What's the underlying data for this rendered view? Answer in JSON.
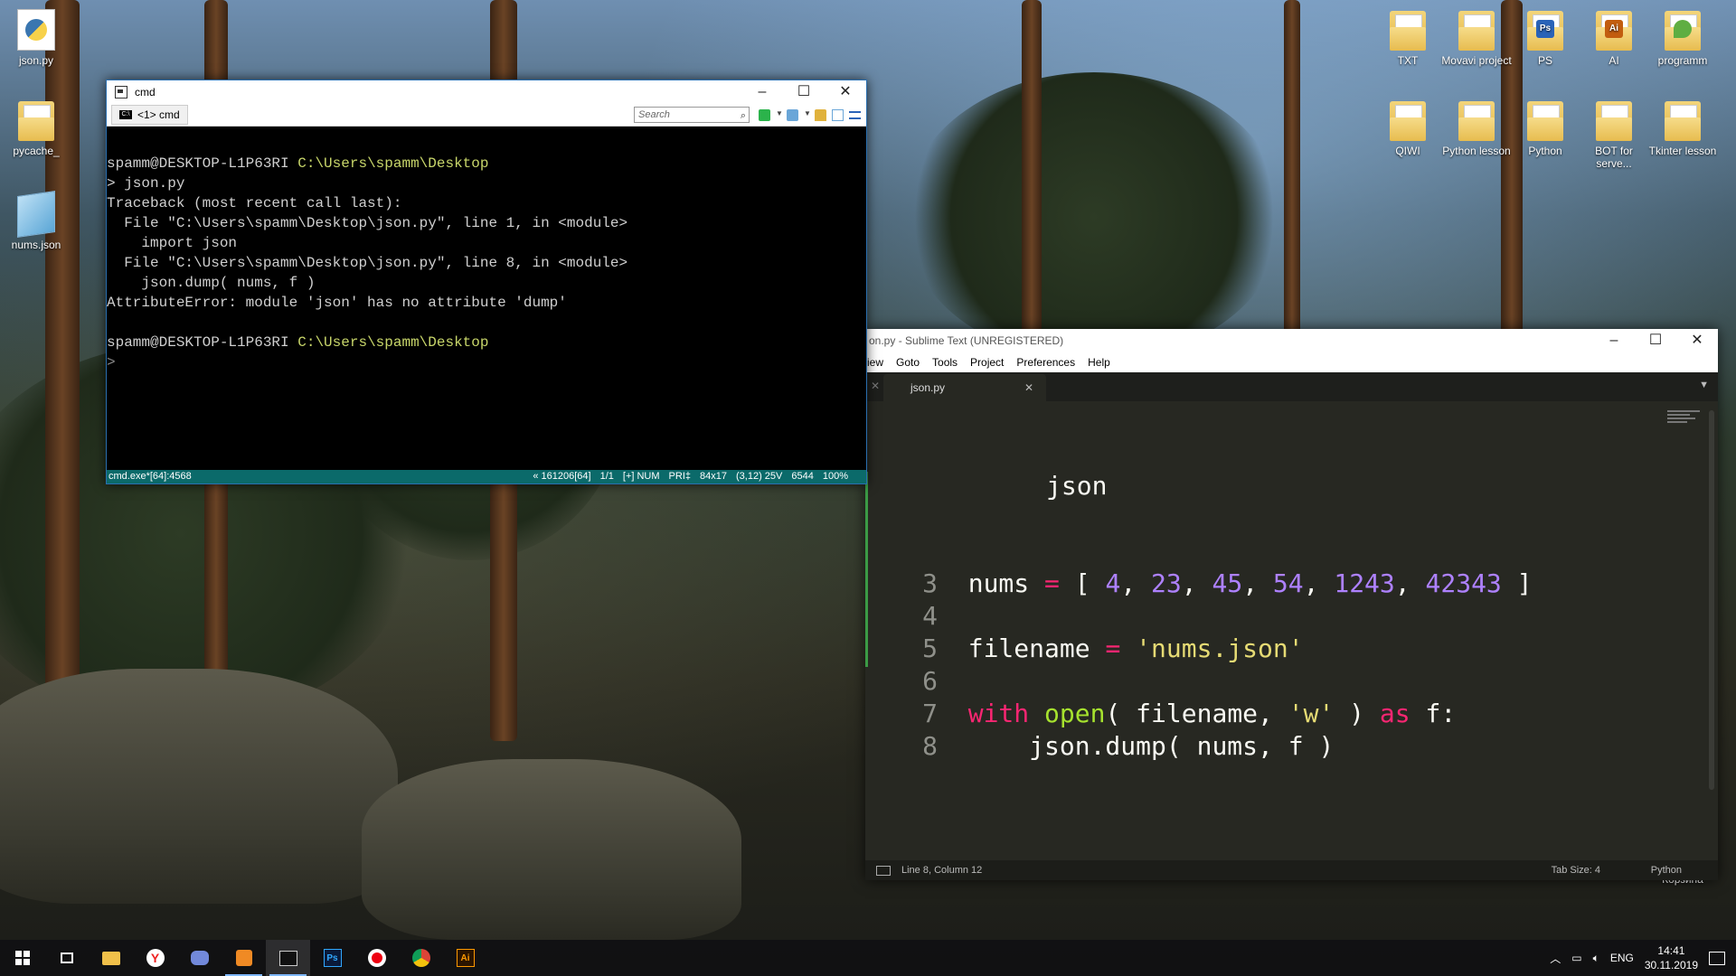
{
  "desktop": {
    "left_icons": [
      {
        "label": "json.py",
        "icon": "python-file-icon"
      },
      {
        "label": "pycache_",
        "icon": "folder-icon"
      },
      {
        "label": "nums.json",
        "icon": "json-file-icon"
      }
    ],
    "right_icons_row1": [
      {
        "label": "TXT"
      },
      {
        "label": "Movavi project"
      },
      {
        "label": "PS",
        "badge": "Ps",
        "badge_color": "#2a63b8"
      },
      {
        "label": "AI",
        "badge": "Ai",
        "badge_color": "#c25d0f"
      },
      {
        "label": "programm",
        "badge": "",
        "badge_color": "#5fae42"
      }
    ],
    "right_icons_row2": [
      {
        "label": "QIWI"
      },
      {
        "label": "Python lesson"
      },
      {
        "label": "Python"
      },
      {
        "label": "BOT for serve..."
      },
      {
        "label": "Tkinter lesson"
      }
    ],
    "recycle_label": "Корзина"
  },
  "cmd": {
    "title": "cmd",
    "tab_label": "<1> cmd",
    "search_placeholder": "Search",
    "prompt_user": "spamm@DESKTOP-L1P63RI",
    "prompt_path": "C:\\Users\\spamm\\Desktop",
    "lines": [
      "> json.py",
      "Traceback (most recent call last):",
      "  File \"C:\\Users\\spamm\\Desktop\\json.py\", line 1, in <module>",
      "    import json",
      "  File \"C:\\Users\\spamm\\Desktop\\json.py\", line 8, in <module>",
      "    json.dump( nums, f )",
      "AttributeError: module 'json' has no attribute 'dump'"
    ],
    "prompt_caret": ">",
    "status_left": "cmd.exe*[64]:4568",
    "status_right": [
      "« 161206[64]",
      "1/1",
      "[+] NUM",
      "PRI‡",
      "84x17",
      "(3,12) 25V",
      "6544",
      "100%"
    ]
  },
  "sublime": {
    "title": "on.py - Sublime Text (UNREGISTERED)",
    "menu": [
      "iew",
      "Goto",
      "Tools",
      "Project",
      "Preferences",
      "Help"
    ],
    "tab_label": "json.py",
    "partial_line_text": "json",
    "code_lines": [
      {
        "n": "3",
        "parts": [
          [
            "",
            "nums "
          ],
          [
            "kw",
            "="
          ],
          [
            "",
            " [ "
          ],
          [
            "num",
            "4"
          ],
          [
            "",
            ", "
          ],
          [
            "num",
            "23"
          ],
          [
            "",
            ", "
          ],
          [
            "num",
            "45"
          ],
          [
            "",
            ", "
          ],
          [
            "num",
            "54"
          ],
          [
            "",
            ", "
          ],
          [
            "num",
            "1243"
          ],
          [
            "",
            ", "
          ],
          [
            "num",
            "42343"
          ],
          [
            "",
            " ]"
          ]
        ]
      },
      {
        "n": "4",
        "parts": []
      },
      {
        "n": "5",
        "parts": [
          [
            "",
            "filename "
          ],
          [
            "kw",
            "="
          ],
          [
            "",
            " "
          ],
          [
            "str",
            "'nums.json'"
          ]
        ]
      },
      {
        "n": "6",
        "parts": []
      },
      {
        "n": "7",
        "parts": [
          [
            "kw",
            "with"
          ],
          [
            "",
            " "
          ],
          [
            "fn",
            "open"
          ],
          [
            "",
            "( filename, "
          ],
          [
            "str",
            "'w'"
          ],
          [
            "",
            " ) "
          ],
          [
            "kw",
            "as"
          ],
          [
            "",
            " f:"
          ]
        ]
      },
      {
        "n": "8",
        "parts": [
          [
            "",
            "    json.dump( nums, f )"
          ]
        ]
      }
    ],
    "status_position": "Line 8, Column 12",
    "status_tab": "Tab Size: 4",
    "status_syntax": "Python"
  },
  "taskbar": {
    "language": "ENG",
    "time": "14:41",
    "date": "30.11.2019"
  }
}
